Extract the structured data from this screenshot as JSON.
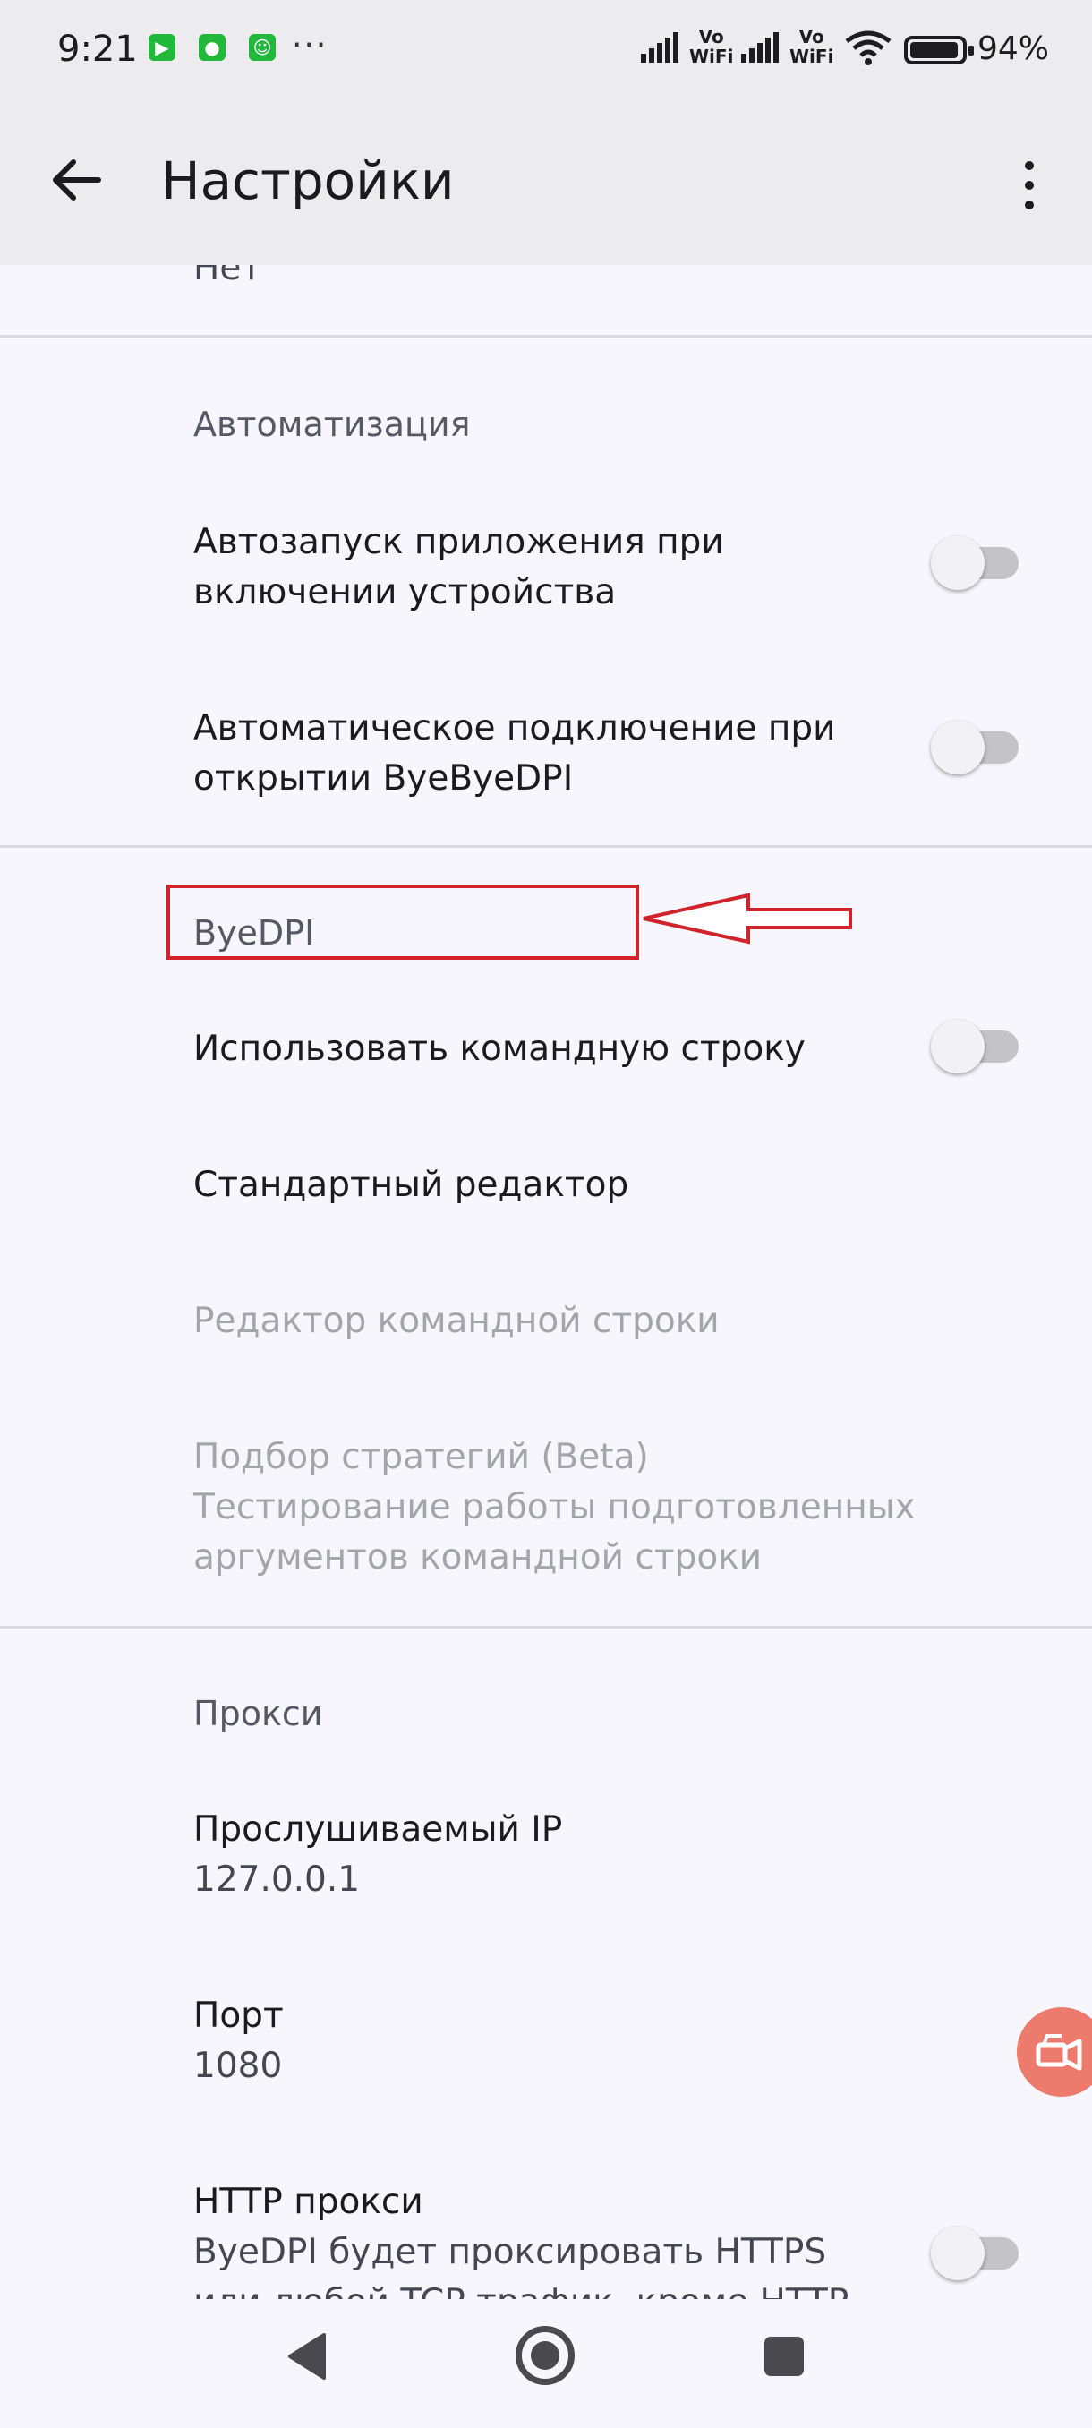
{
  "status_bar": {
    "time": "9:21",
    "more": "···",
    "vo_wifi_1": "Vo\nWiFi",
    "vo_wifi_2": "Vo\nWiFi",
    "battery_percent": "94%",
    "battery_level": 0.94
  },
  "app_bar": {
    "title": "Настройки"
  },
  "settings": {
    "partial_value": "Нет",
    "automation": {
      "header": "Автоматизация",
      "autostart": {
        "line1": "Автозапуск приложения при",
        "line2": "включении устройства",
        "enabled": false
      },
      "autoconnect": {
        "line1": "Автоматическое подключение при",
        "line2": "открытии ByeByeDPI",
        "enabled": false
      }
    },
    "byedpi": {
      "header": "ByeDPI",
      "use_cmdline": {
        "label": "Использовать командную строку",
        "enabled": false
      },
      "standard_editor": "Стандартный редактор",
      "cmdline_editor": "Редактор командной строки",
      "strategy": {
        "title": "Подбор стратегий (Beta)",
        "line1": "Тестирование работы подготовленных",
        "line2": "аргументов командной строки"
      }
    },
    "proxy": {
      "header": "Прокси",
      "listen_ip": {
        "label": "Прослушиваемый IP",
        "value": "127.0.0.1"
      },
      "port": {
        "label": "Порт",
        "value": "1080"
      },
      "http_proxy": {
        "label": "HTTP прокси",
        "line1": "ByeDPI будет проксировать HTTPS",
        "line2": "или любой TCP трафик, кроме HTTP",
        "enabled": false
      }
    }
  },
  "colors": {
    "background": "#f7f6fd",
    "app_bar": "#ececee",
    "highlight": "#d0232b",
    "float_button": "#ec7b6d"
  }
}
